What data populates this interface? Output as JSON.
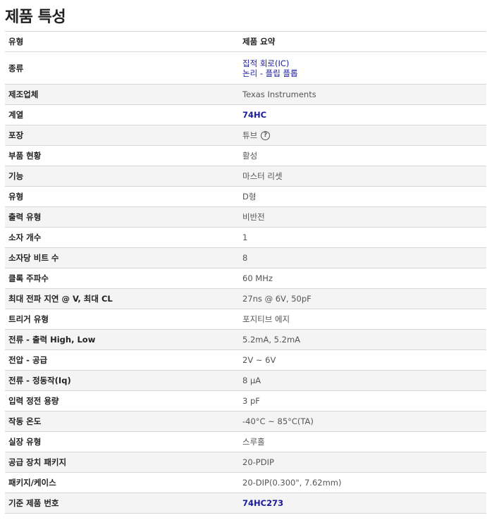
{
  "title": "제품 특성",
  "header": {
    "key": "유형",
    "value": "제품 요약"
  },
  "rows": [
    {
      "key": "종류",
      "links": [
        "집적 회로(IC)",
        "논리 - 플립 플롭"
      ]
    },
    {
      "key": "제조업체",
      "value": "Texas Instruments"
    },
    {
      "key": "계열",
      "value": "74HC",
      "link": true
    },
    {
      "key": "포장",
      "value": "튜브",
      "help_icon": "question-circle-icon"
    },
    {
      "key": "부품 현황",
      "value": "활성"
    },
    {
      "key": "기능",
      "value": "마스터 리셋"
    },
    {
      "key": "유형",
      "value": "D형"
    },
    {
      "key": "출력 유형",
      "value": "비반전"
    },
    {
      "key": "소자 개수",
      "value": "1"
    },
    {
      "key": "소자당 비트 수",
      "value": "8"
    },
    {
      "key": "클록 주파수",
      "value": "60 MHz"
    },
    {
      "key": "최대 전파 지연 @ V, 최대 CL",
      "value": "27ns @ 6V, 50pF"
    },
    {
      "key": "트리거 유형",
      "value": "포지티브 에지"
    },
    {
      "key": "전류 - 출력 High, Low",
      "value": "5.2mA, 5.2mA"
    },
    {
      "key": "전압 - 공급",
      "value": "2V ~ 6V"
    },
    {
      "key": "전류 - 정동작(Iq)",
      "value": "8 µA"
    },
    {
      "key": "입력 정전 용량",
      "value": "3 pF"
    },
    {
      "key": "작동 온도",
      "value": "-40°C ~ 85°C(TA)"
    },
    {
      "key": "실장 유형",
      "value": "스루홀"
    },
    {
      "key": "공급 장치 패키지",
      "value": "20-PDIP"
    },
    {
      "key": "패키지/케이스",
      "value": "20-DIP(0.300\", 7.62mm)"
    },
    {
      "key": "기준 제품 번호",
      "value": "74HC273",
      "link": true
    }
  ],
  "colors": {
    "link": "#1a1a9e",
    "row_alt": "#f4f4f4",
    "border": "#d8d8d8"
  }
}
